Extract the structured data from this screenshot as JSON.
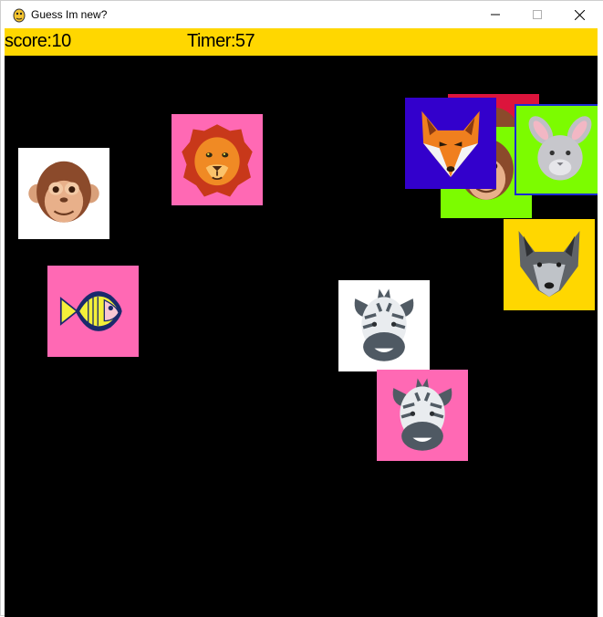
{
  "window": {
    "title": "Guess Im new?",
    "minimize_icon": "minimize-icon",
    "maximize_icon": "maximize-icon",
    "close_icon": "close-icon"
  },
  "hud": {
    "score": "score:10",
    "timer": "Timer:57",
    "bar_color": "#ffd700"
  },
  "cards": [
    {
      "animal": "monkey-icon",
      "bg": "#ffffff"
    },
    {
      "animal": "lion-icon",
      "bg": "#ff69b4"
    },
    {
      "animal": "fish-icon",
      "bg": "#ff69b4"
    },
    {
      "animal": "monkey-icon",
      "bg": "#7cfc00"
    },
    {
      "animal": "fox-icon",
      "bg": "#3300cc"
    },
    {
      "animal": "rabbit-icon",
      "bg": "#7cfc00"
    },
    {
      "animal": "wolf-icon",
      "bg": "#ffd700"
    },
    {
      "animal": "zebra-icon",
      "bg": "#ffffff"
    },
    {
      "animal": "zebra-icon",
      "bg": "#ff69b4"
    }
  ]
}
